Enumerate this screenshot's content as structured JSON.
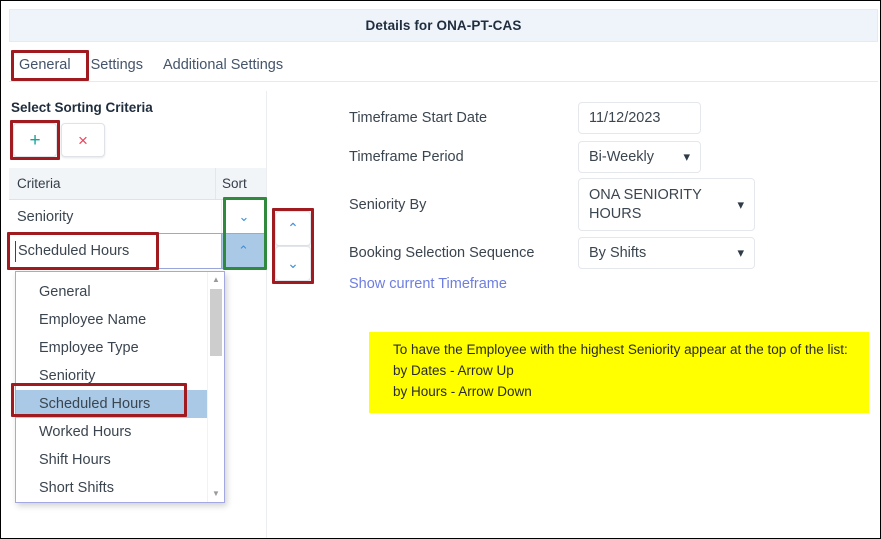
{
  "header": {
    "title": "Details for ONA-PT-CAS"
  },
  "tabs": [
    {
      "label": "General",
      "active": true
    },
    {
      "label": "Settings",
      "active": false
    },
    {
      "label": "Additional Settings",
      "active": false
    }
  ],
  "left_panel": {
    "section_label": "Select Sorting Criteria",
    "toolbar": {
      "add_label": "+",
      "delete_label": "×"
    },
    "grid": {
      "columns": [
        "Criteria",
        "Sort"
      ],
      "rows": [
        {
          "criteria": "Seniority",
          "sort": "chevron-down",
          "sort_glyph": "⌄",
          "selected": false
        },
        {
          "criteria": "Scheduled Hours",
          "sort": "chevron-up",
          "sort_glyph": "⌃",
          "selected": true
        }
      ]
    },
    "editor": {
      "value": "Scheduled Hours",
      "sort_glyph": "⌃"
    },
    "dropdown_options": [
      "General",
      "Employee Name",
      "Employee Type",
      "Seniority",
      "Scheduled Hours",
      "Worked Hours",
      "Shift Hours",
      "Short Shifts"
    ],
    "dropdown_selected": "Scheduled Hours",
    "reorder": {
      "up_glyph": "⌃",
      "down_glyph": "⌄"
    }
  },
  "form": {
    "fields": [
      {
        "label": "Timeframe Start Date",
        "value": "11/12/2023",
        "type": "text"
      },
      {
        "label": "Timeframe Period",
        "value": "Bi-Weekly",
        "type": "select"
      },
      {
        "label": "Seniority By",
        "value": "ONA SENIORITY HOURS",
        "type": "select"
      },
      {
        "label": "Booking Selection Sequence",
        "value": "By Shifts",
        "type": "select"
      }
    ],
    "link_label": "Show current Timeframe"
  },
  "note": {
    "line1": "To have the Employee with the highest Seniority appear at the top of the list:",
    "line2": "by Dates - Arrow Up",
    "line3": "by Hours - Arrow Down"
  },
  "colors": {
    "header_bg": "#eff4fb",
    "highlight_red": "#a01b20",
    "highlight_green": "#2f8a3e",
    "accent_blue": "#3f8edc",
    "selection_blue": "#a9c9e6",
    "note_yellow": "#ffff00",
    "link": "#6e7ee0",
    "add_green": "#17a398",
    "delete_red": "#e8455b"
  }
}
